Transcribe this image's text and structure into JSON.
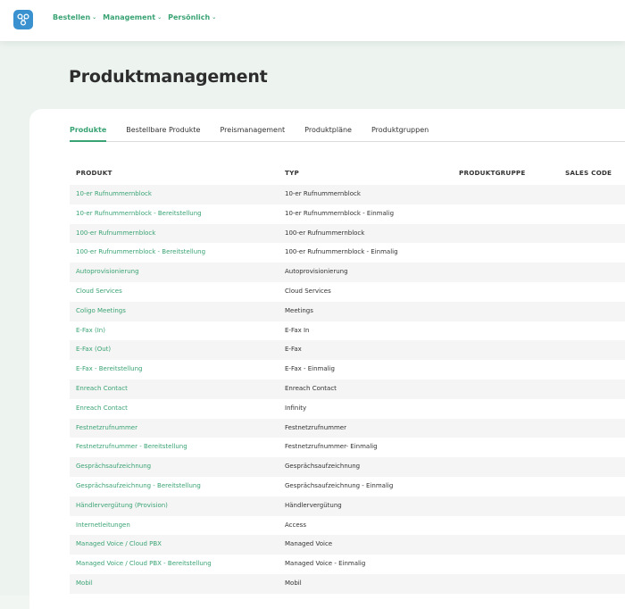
{
  "nav": {
    "items": [
      {
        "label": "Bestellen"
      },
      {
        "label": "Management"
      },
      {
        "label": "Persönlich"
      }
    ]
  },
  "page": {
    "title": "Produktmanagement"
  },
  "tabs": [
    {
      "label": "Produkte",
      "active": true
    },
    {
      "label": "Bestellbare Produkte"
    },
    {
      "label": "Preismanagement"
    },
    {
      "label": "Produktpläne"
    },
    {
      "label": "Produktgruppen"
    }
  ],
  "table": {
    "headers": {
      "produkt": "PRODUKT",
      "typ": "TYP",
      "produktgruppe": "PRODUKTGRUPPE",
      "sales_code": "SALES CODE"
    },
    "rows": [
      {
        "produkt": "10-er Rufnummernblock",
        "typ": "10-er Rufnummernblock"
      },
      {
        "produkt": "10-er Rufnummernblock - Bereitstellung",
        "typ": "10-er Rufnummernblock - Einmalig"
      },
      {
        "produkt": "100-er Rufnummernblock",
        "typ": "100-er Rufnummernblock"
      },
      {
        "produkt": "100-er Rufnummernblock - Bereitstellung",
        "typ": "100-er Rufnummernblock - Einmalig"
      },
      {
        "produkt": "Autoprovisionierung",
        "typ": "Autoprovisionierung"
      },
      {
        "produkt": "Cloud Services",
        "typ": "Cloud Services"
      },
      {
        "produkt": "Coligo Meetings",
        "typ": "Meetings"
      },
      {
        "produkt": "E-Fax (In)",
        "typ": "E-Fax In"
      },
      {
        "produkt": "E-Fax (Out)",
        "typ": "E-Fax"
      },
      {
        "produkt": "E-Fax - Bereitstellung",
        "typ": "E-Fax - Einmalig"
      },
      {
        "produkt": "Enreach Contact",
        "typ": "Enreach Contact"
      },
      {
        "produkt": "Enreach Contact",
        "typ": "Infinity"
      },
      {
        "produkt": "Festnetzrufnummer",
        "typ": "Festnetzrufnummer"
      },
      {
        "produkt": "Festnetzrufnummer - Bereitstellung",
        "typ": "Festnetzrufnummer- Einmalig"
      },
      {
        "produkt": "Gesprächsaufzeichnung",
        "typ": "Gesprächsaufzeichnung"
      },
      {
        "produkt": "Gesprächsaufzeichnung - Bereitstellung",
        "typ": "Gesprächsaufzeichnung - Einmalig"
      },
      {
        "produkt": "Händlervergütung (Provision)",
        "typ": "Händlervergütung"
      },
      {
        "produkt": "Internetleitungen",
        "typ": "Access"
      },
      {
        "produkt": "Managed Voice / Cloud PBX",
        "typ": "Managed Voice"
      },
      {
        "produkt": "Managed Voice / Cloud PBX - Bereitstellung",
        "typ": "Managed Voice - Einmalig"
      },
      {
        "produkt": "Mobil",
        "typ": "Mobil"
      }
    ]
  },
  "colors": {
    "accent": "#3aa374",
    "logo": "#3a91cf"
  }
}
